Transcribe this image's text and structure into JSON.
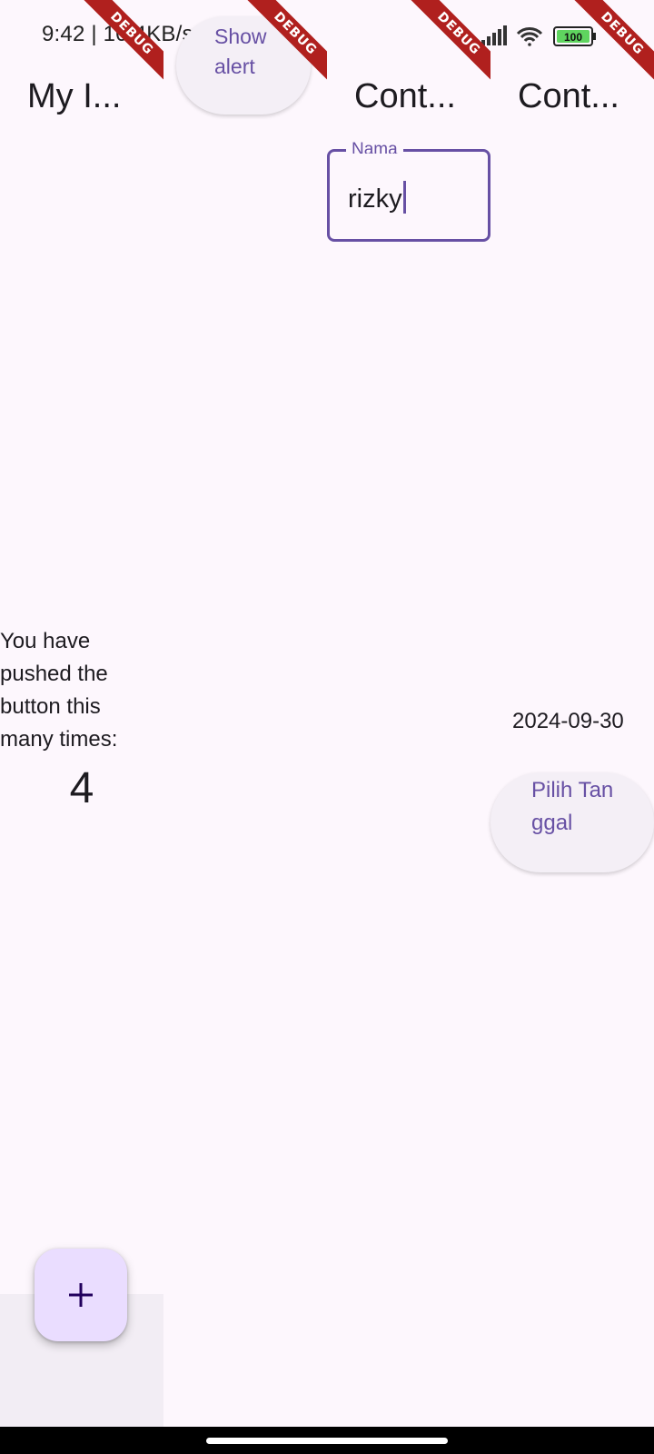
{
  "status_bar": {
    "time_speed": "9:42 | 10.4KB/s",
    "battery": "100",
    "icons": [
      "bell-off-icon",
      "alarm-icon",
      "app-notification-icon",
      "signal-icon",
      "wifi-icon",
      "battery-icon"
    ]
  },
  "debug_banner": "DEBUG",
  "column1": {
    "title": "My I...",
    "counter_label": "You have pushed the button this many times:",
    "counter_value": "4",
    "fab_label": "+"
  },
  "column2": {
    "button_label": "Show alert"
  },
  "column3": {
    "title": "Cont...",
    "field_label": "Nama",
    "field_value": "rizky"
  },
  "column4": {
    "title": "Cont...",
    "date": "2024-09-30",
    "button_label": "Pilih Tanggal"
  },
  "colors": {
    "background": "#fdf7fd",
    "primary": "#6750a4",
    "fab_bg": "#eaddff",
    "debug_red": "#b0201e"
  }
}
